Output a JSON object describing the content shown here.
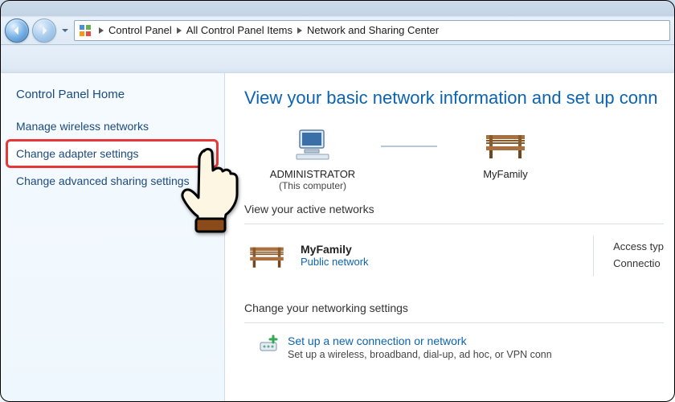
{
  "breadcrumb": {
    "seg1": "Control Panel",
    "seg2": "All Control Panel Items",
    "seg3": "Network and Sharing Center"
  },
  "sidebar": {
    "home": "Control Panel Home",
    "links": {
      "manage_wireless": "Manage wireless networks",
      "change_adapter": "Change adapter settings",
      "change_advanced": "Change advanced sharing settings"
    }
  },
  "main": {
    "title": "View your basic network information and set up conn",
    "node1_label": "ADMINISTRATOR",
    "node1_sub": "(This computer)",
    "node2_label": "MyFamily",
    "active_networks_heading": "View your active networks",
    "active": {
      "name": "MyFamily",
      "type": "Public network",
      "access_label": "Access typ",
      "connect_label": "Connectio"
    },
    "change_heading": "Change your networking settings",
    "wizard": {
      "link": "Set up a new connection or network",
      "desc": "Set up a wireless, broadband, dial-up, ad hoc, or VPN conn"
    }
  }
}
